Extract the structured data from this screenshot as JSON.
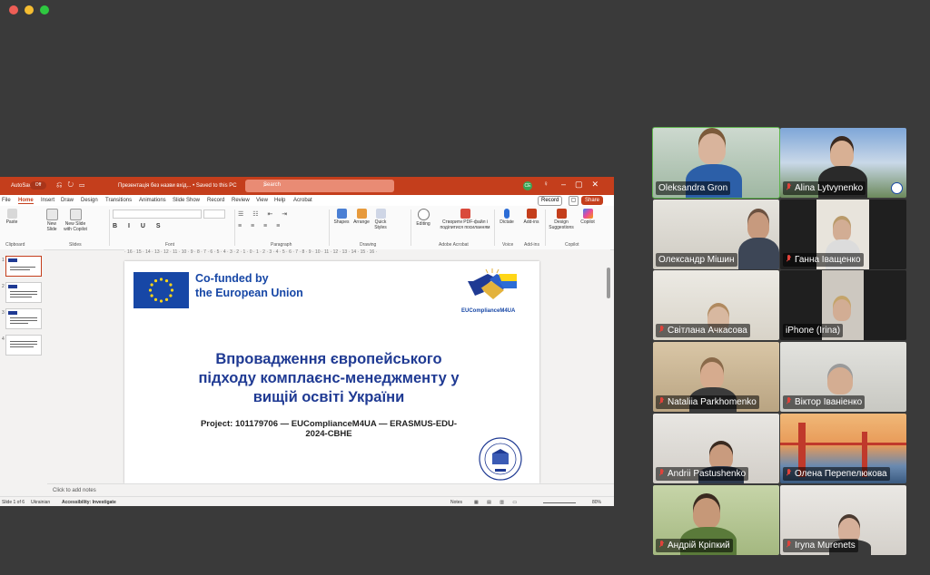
{
  "window": {
    "traffic_lights": [
      "close",
      "minimize",
      "zoom"
    ]
  },
  "ppt": {
    "titlebar": {
      "autosave": "AutoSave",
      "autosave_state": "Off",
      "doc_name": "Презентація без назви вхід... • Saved to this PC",
      "search_placeholder": "Search",
      "user_initials": "CE"
    },
    "menu": {
      "tabs": [
        "File",
        "Home",
        "Insert",
        "Draw",
        "Design",
        "Transitions",
        "Animations",
        "Slide Show",
        "Record",
        "Review",
        "View",
        "Help",
        "Acrobat"
      ],
      "active": "Home",
      "record": "Record",
      "share": "Share"
    },
    "ribbon": {
      "paste": "Paste",
      "new_slide": "New Slide",
      "new_slide_copilot": "New Slide with Copilot",
      "shapes": "Shapes",
      "arrange": "Arrange",
      "quick_styles": "Quick Styles",
      "editing": "Editing",
      "create_pdf": "Створити PDF-файл і поділитися посиланням",
      "dictate": "Dictate",
      "addins": "Add-ins",
      "design_suggestions": "Design Suggestions",
      "copilot": "Copilot",
      "groups": [
        "Clipboard",
        "Slides",
        "Font",
        "Paragraph",
        "Drawing",
        "Adobe Acrobat",
        "Voice",
        "Add-ins",
        "Copilot"
      ]
    },
    "ruler_text": "· 16 · 15 · 14 · 13 · 12 · 11 · 10 · 9 · 8 · 7 · 6 · 5 · 4 · 3 · 2 · 1 · 0 · 1 · 2 · 3 · 4 · 5 · 6 · 7 · 8 · 9 · 10 · 11 · 12 · 13 · 14 · 15 · 16 ·",
    "thumbs": [
      "1",
      "2",
      "3",
      "4"
    ],
    "slide": {
      "cofunded_line1": "Co-funded by",
      "cofunded_line2": "the European Union",
      "logo_text": "EUComplianceM4UA",
      "title_line1": "Впровадження європейського",
      "title_line2": "підходу комплаєнс-менеджменту у",
      "title_line3": "вищій освіті України",
      "project_line1": "Project: 101179706 — EUComplianceM4UA — ERASMUS-EDU-",
      "project_line2": "2024-CBHE"
    },
    "notes_placeholder": "Click to add notes",
    "status": {
      "slide_count": "Slide 1 of 6",
      "language": "Ukrainian",
      "accessibility": "Accessibility: Investigate",
      "notes": "Notes",
      "zoom": "80%"
    }
  },
  "gallery": {
    "participants": [
      {
        "name": "Oleksandra Gron",
        "muted": false,
        "active": true
      },
      {
        "name": "Alina Lytvynenko",
        "muted": true,
        "active": false
      },
      {
        "name": "Олександр Мішин",
        "muted": false,
        "active": false
      },
      {
        "name": "Ганна Іващенко",
        "muted": true,
        "active": false
      },
      {
        "name": "Світлана Ачкасова",
        "muted": true,
        "active": false
      },
      {
        "name": "iPhone (Irina)",
        "muted": false,
        "active": false
      },
      {
        "name": "Nataliia Parkhomenko",
        "muted": true,
        "active": false
      },
      {
        "name": "Віктор Іваніенко",
        "muted": true,
        "active": false
      },
      {
        "name": "Andrii Pastushenko",
        "muted": true,
        "active": false
      },
      {
        "name": "Олена Перепелюкова",
        "muted": true,
        "active": false
      },
      {
        "name": "Андрій Кріпкий",
        "muted": true,
        "active": false
      },
      {
        "name": "Iryna Murenets",
        "muted": true,
        "active": false
      }
    ]
  },
  "colors": {
    "ppt_accent": "#c43e1c",
    "eu_blue": "#1747a6",
    "zoom_active": "#5fb54e",
    "mute_red": "#e0433b",
    "background": "#3a3a3a"
  }
}
